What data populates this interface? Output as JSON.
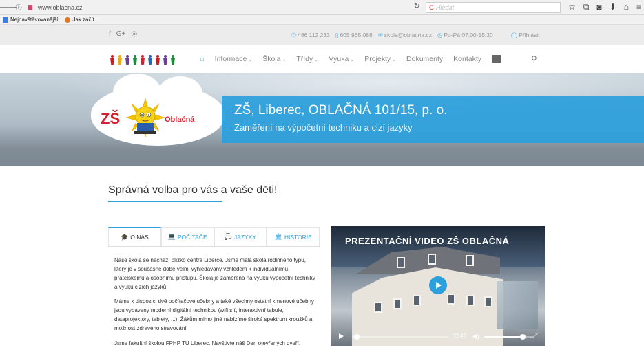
{
  "browser": {
    "url": "www.oblacna.cz",
    "search_placeholder": "Hledat",
    "back_icon": "back-arrow-icon"
  },
  "bookmarks": [
    {
      "label": "Nejnavštěvovanější"
    },
    {
      "label": "Jak začít"
    }
  ],
  "topbar": {
    "social": [
      "f",
      "G+",
      "◎"
    ],
    "phone1": "486 112 233",
    "phone2": "605 965 088",
    "email": "skola@oblacna.cz",
    "hours": "Po-Pá 07:00-15:30",
    "login": "Přihlásit"
  },
  "nav": {
    "items": [
      {
        "label": "Informace"
      },
      {
        "label": "Škola"
      },
      {
        "label": "Třídy"
      },
      {
        "label": "Výuka"
      },
      {
        "label": "Projekty"
      },
      {
        "label": "Dokumenty"
      },
      {
        "label": "Kontakty"
      }
    ]
  },
  "logo": {
    "zs": "ZŠ",
    "name": "Oblačná",
    "people_colors": [
      "#c8201e",
      "#e6a818",
      "#6a3d9a",
      "#1f8a3e",
      "#d42030",
      "#2a68b5",
      "#c8201e",
      "#6a3d9a",
      "#1f8a3e"
    ]
  },
  "hero": {
    "title": "ZŠ, Liberec, OBLAČNÁ 101/15, p. o.",
    "subtitle": "Zaměření na výpočetní techniku a cizí jazyky"
  },
  "main": {
    "heading": "Správná volba pro vás a vaše děti!",
    "tabs": [
      {
        "label": "O NÁS",
        "icon": "graduation-cap-icon",
        "glyph": "🎓",
        "active": true
      },
      {
        "label": "POČÍTAČE",
        "icon": "laptop-icon",
        "glyph": "💻",
        "active": false
      },
      {
        "label": "JAZYKY",
        "icon": "chat-icon",
        "glyph": "💬",
        "active": false
      },
      {
        "label": "HISTORIE",
        "icon": "bank-icon",
        "glyph": "🏛",
        "active": false
      }
    ],
    "paragraphs": [
      "Naše škola se nachází blízko centra Liberce. Jsme malá škola rodinného typu, který je v současné době velmi vyhledávaný vzhledem k individuálnímu, přátelskému a osobnímu přístupu. Škola je zaměřená na výuku výpočetní techniky a výuku cizích jazyků.",
      "Máme k dispozici dvě počítačové učebny a také všechny ostatní kmenové učebny jsou vybaveny moderní digitální technikou (wifi síť, interaktivní tabule, dataprojektory, tablety, ...). Žákům mimo jiné nabízíme široké spektrum kroužků a možnost zdravého stravování.",
      "Jsme fakultní školou FPHP TU Liberec. Navštivte náš Den otevřených dveří."
    ]
  },
  "video": {
    "title": "PREZENTAČNÍ VIDEO ZŠ OBLAČNÁ",
    "time": "02:47",
    "progress": 0.02,
    "volume": 0.8
  },
  "colors": {
    "accent": "#2ba0dc",
    "logo_red": "#d4202e"
  }
}
